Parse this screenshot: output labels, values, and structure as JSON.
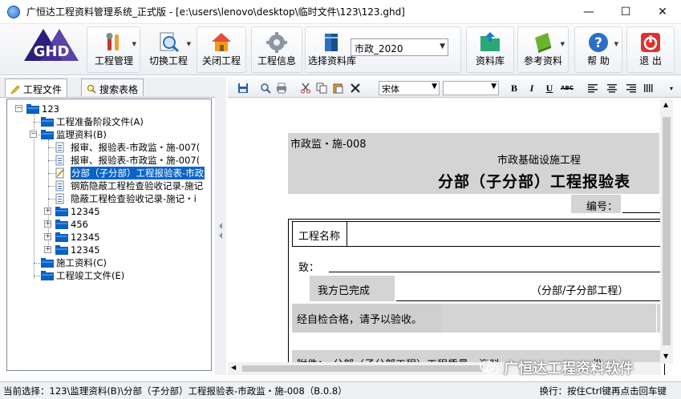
{
  "window": {
    "title": "广恒达工程资料管理系统_正式版 - [e:\\users\\lenovo\\desktop\\临时文件\\123\\123.ghd]",
    "minimize": "—",
    "maximize": "☐",
    "close": "✕"
  },
  "toolbar": {
    "project_mgmt": "工程管理",
    "switch_project": "切换工程",
    "close_project": "关闭工程",
    "project_info": "工程信息",
    "select_library": "选择资料库",
    "library_value": "市政_2020",
    "library": "资料库",
    "reference": "参考资料",
    "help": "帮 助",
    "exit": "退 出"
  },
  "left_tabs": {
    "files": "工程文件",
    "search": "搜索表格"
  },
  "tree": [
    {
      "label": "123",
      "level": 0,
      "type": "folder",
      "exp": "−"
    },
    {
      "label": "工程准备阶段文件(A)",
      "level": 1,
      "type": "folder",
      "exp": ""
    },
    {
      "label": "监理资料(B)",
      "level": 1,
      "type": "folder",
      "exp": "−"
    },
    {
      "label": "报审、报验表-市政监・施-007(",
      "level": 2,
      "type": "doc",
      "exp": ""
    },
    {
      "label": "报审、报验表-市政监・施-007(",
      "level": 2,
      "type": "doc",
      "exp": ""
    },
    {
      "label": "分部（子分部）工程报验表-市政",
      "level": 2,
      "type": "doc-edit",
      "exp": "",
      "selected": true
    },
    {
      "label": "钢筋隐蔽工程检查验收记录-施记",
      "level": 2,
      "type": "doc",
      "exp": ""
    },
    {
      "label": "隐蔽工程检查验收记录-施记・i",
      "level": 2,
      "type": "doc",
      "exp": ""
    },
    {
      "label": "12345",
      "level": 2,
      "type": "folder",
      "exp": "+"
    },
    {
      "label": "456",
      "level": 2,
      "type": "folder",
      "exp": "+"
    },
    {
      "label": "12345",
      "level": 2,
      "type": "folder",
      "exp": "+"
    },
    {
      "label": "12345",
      "level": 2,
      "type": "folder",
      "exp": "+"
    },
    {
      "label": "施工资料(C)",
      "level": 1,
      "type": "folder",
      "exp": ""
    },
    {
      "label": "工程竣工文件(E)",
      "level": 1,
      "type": "folder",
      "exp": ""
    }
  ],
  "editor_toolbar": {
    "font": "宋体",
    "size": "",
    "bold": "B",
    "italic": "I",
    "underline": "U",
    "abc": "ABC"
  },
  "document": {
    "form_code": "市政监・施-008",
    "subtitle": "市政基础设施工程",
    "title": "分部（子分部）工程报验表",
    "number_label": "编号：",
    "project_name_label": "工程名称",
    "to_label": "致：",
    "completed_label": "我方已完成",
    "part_label": "（分部/子分部工程）",
    "inspect_text": "经自检合格，请予以验收。",
    "attach_label": "附件：",
    "attach_text": "分部（子分部工程）工程质量・资料",
    "copies": "份"
  },
  "status": {
    "current": "当前选择：123\\监理资料(B)\\分部（子分部）工程报验表-市政监・施-008（B.0.8）",
    "hint": "换行：按住Ctrl键再点击回车键"
  },
  "watermark": "广恒达工程资料软件"
}
